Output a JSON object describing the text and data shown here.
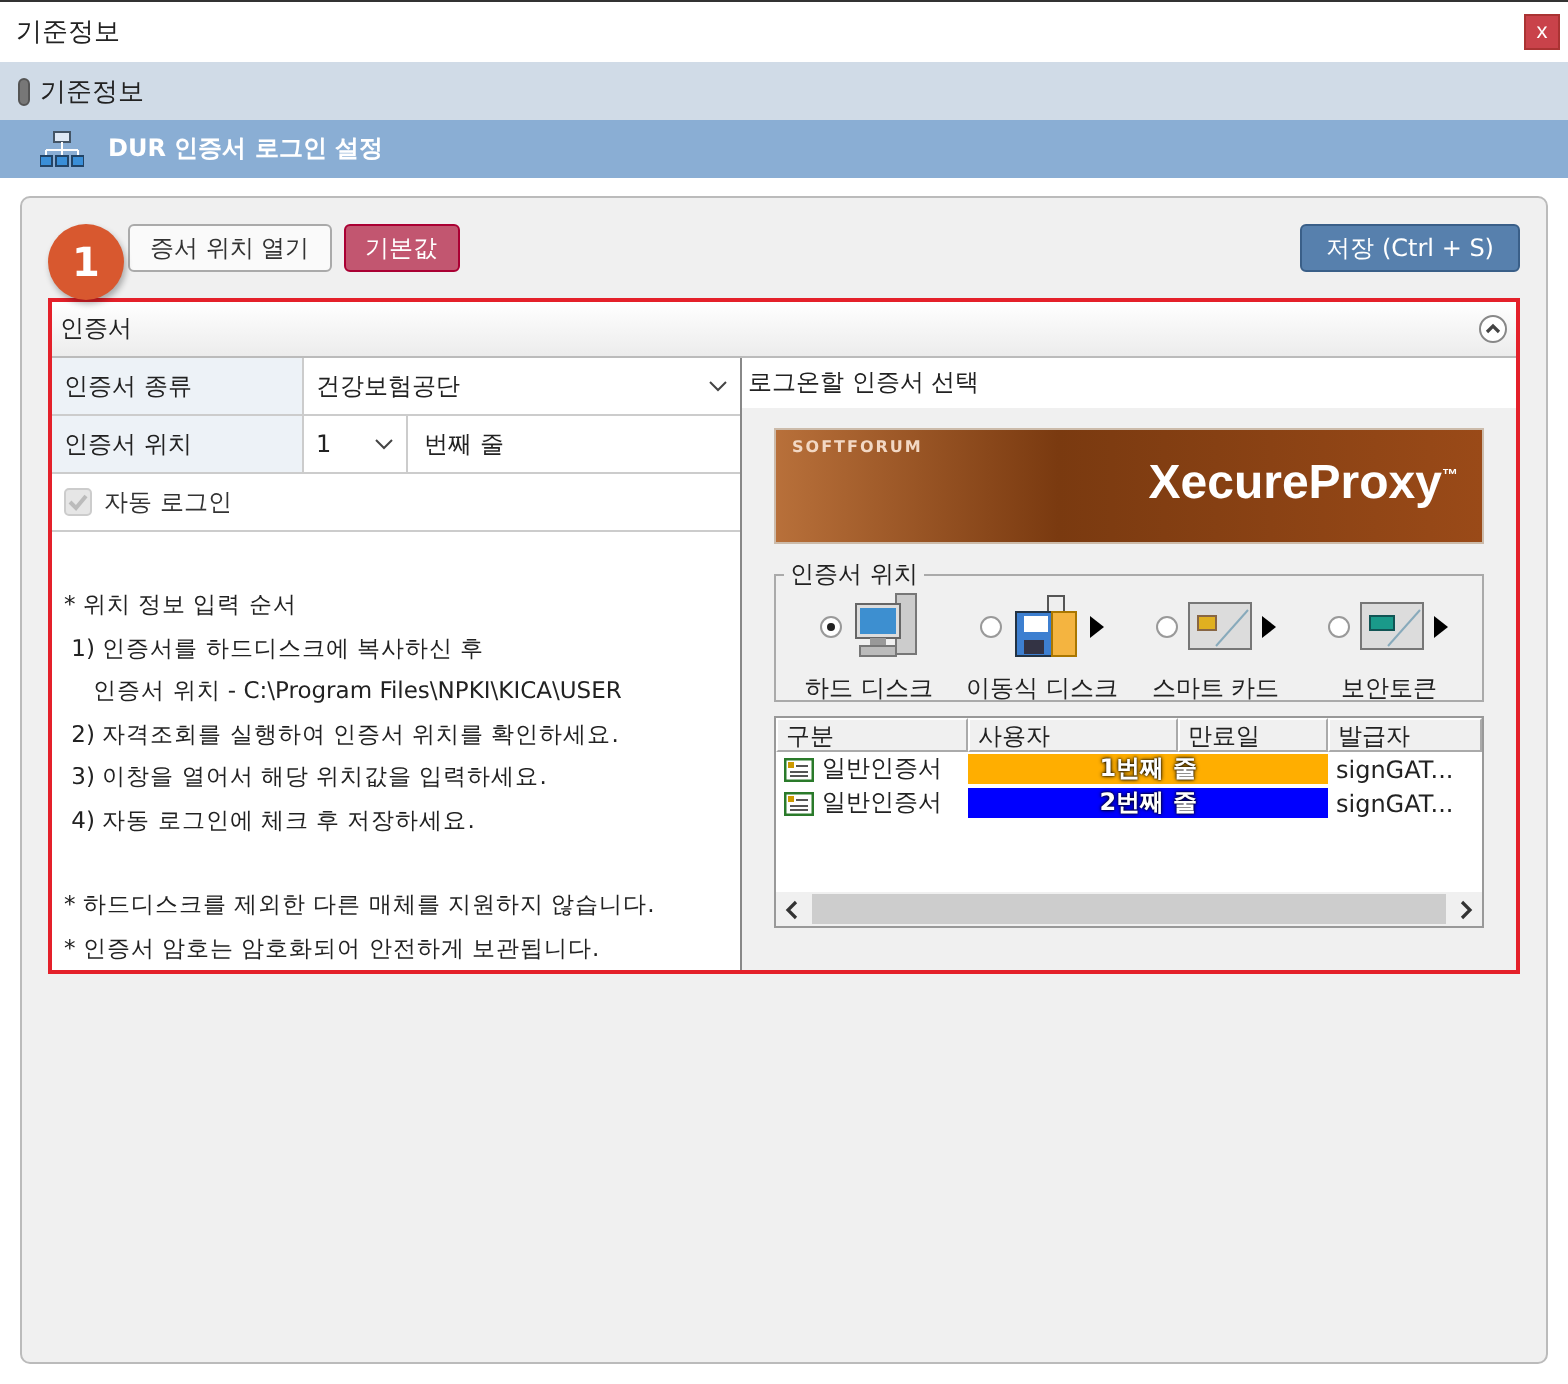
{
  "window": {
    "title": "기준정보",
    "close": "x"
  },
  "breadcrumb": "기준정보",
  "header": "DUR 인증서 로그인 설정",
  "badge": "1",
  "buttons": [
    {
      "label": "증서 위치 열기",
      "kind": "plain"
    },
    {
      "label": "기본값",
      "kind": "reset"
    },
    {
      "label": "저장 (Ctrl + S)",
      "kind": "save"
    }
  ],
  "section": {
    "title": "인증서",
    "expanded": true
  },
  "form": {
    "type_label": "인증서 종류",
    "type_value": "건강보험공단",
    "location_label": "인증서 위치",
    "location_value": "1",
    "location_suffix": "번째 줄",
    "auto_login": {
      "label": "자동 로그인",
      "checked": true,
      "disabled": true
    }
  },
  "notes": [
    [
      "* 위치 정보 입력 순서",
      " 1) 인증서를 하드디스크에 복사하신 후",
      "    인증서 위치 - C:\\Program Files\\NPKI\\KICA\\USER",
      " 2) 자격조회를 실행하여 인증서 위치를 확인하세요.",
      " 3) 이창을 열어서 해당 위치값을 입력하세요.",
      " 4) 자동 로그인에 체크 후 저장하세요."
    ],
    [
      "* 하드디스크를 제외한 다른 매체를 지원하지 않습니다.",
      "* 인증서 암호는 암호화되어 안전하게 보관됩니다."
    ]
  ],
  "picker": {
    "title": "로그온할 인증서 선택",
    "banner": {
      "brand": "SOFTFORUM",
      "product": "XecureProxy",
      "mark": "™"
    },
    "group_title": "인증서 위치",
    "devices": [
      {
        "label": "하드 디스크",
        "kind": "harddisk",
        "selected": true,
        "submenu": false
      },
      {
        "label": "이동식 디스크",
        "kind": "removable",
        "selected": false,
        "submenu": true
      },
      {
        "label": "스마트 카드",
        "kind": "smartcard",
        "selected": false,
        "submenu": true
      },
      {
        "label": "보안토큰",
        "kind": "token",
        "selected": false,
        "submenu": true
      }
    ],
    "columns": [
      "구분",
      "사용자",
      "만료일",
      "발급자"
    ],
    "rows": [
      {
        "type": "일반인증서",
        "user": "1번째 줄",
        "issuer": "signGAT...",
        "color": "#ffae00"
      },
      {
        "type": "일반인증서",
        "user": "2번째 줄",
        "issuer": "signGAT...",
        "color": "#0000ff"
      }
    ]
  }
}
